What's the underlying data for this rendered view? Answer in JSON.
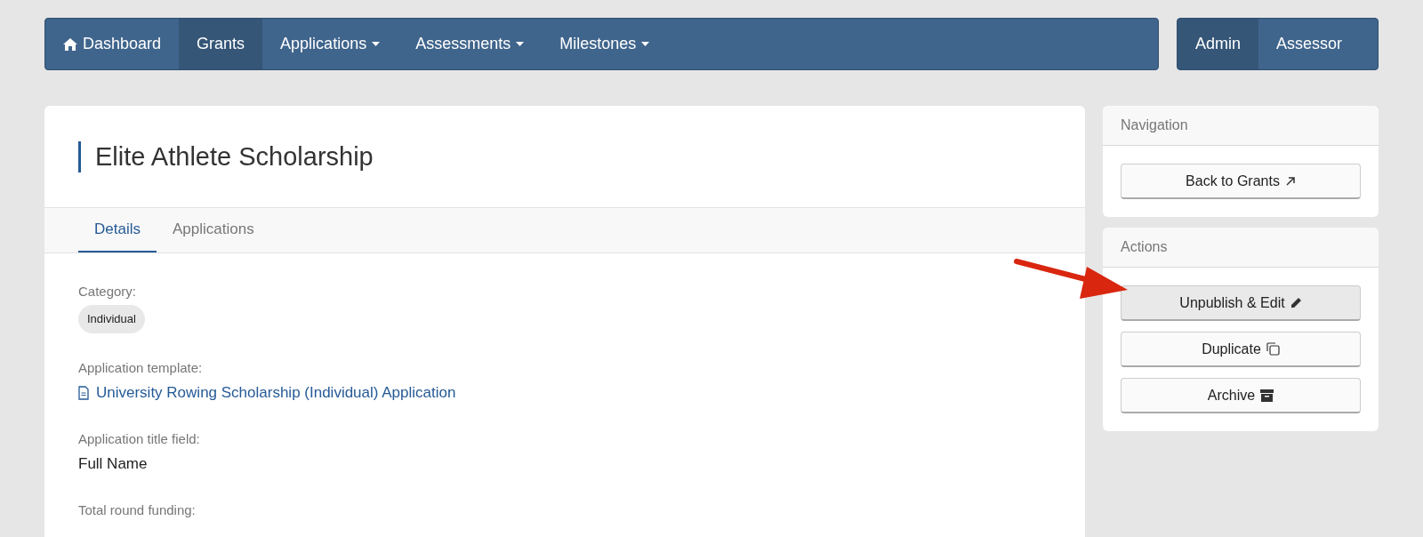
{
  "navbar": {
    "items": [
      {
        "label": "Dashboard",
        "dropdown": false,
        "selected": false
      },
      {
        "label": "Grants",
        "dropdown": false,
        "selected": true
      },
      {
        "label": "Applications",
        "dropdown": true,
        "selected": false
      },
      {
        "label": "Assessments",
        "dropdown": true,
        "selected": false
      },
      {
        "label": "Milestones",
        "dropdown": true,
        "selected": false
      }
    ],
    "roles": [
      {
        "label": "Admin",
        "selected": true
      },
      {
        "label": "Assessor",
        "selected": false
      }
    ]
  },
  "grant": {
    "title": "Elite Athlete Scholarship",
    "tabs": [
      {
        "label": "Details",
        "selected": true
      },
      {
        "label": "Applications",
        "selected": false
      }
    ],
    "fields": [
      {
        "label": "Category:",
        "kind": "tag",
        "value": "Individual"
      },
      {
        "label": "Application template:",
        "kind": "link",
        "value": "University Rowing Scholarship (Individual) Application"
      },
      {
        "label": "Application title field:",
        "kind": "text",
        "value": "Full Name"
      },
      {
        "label": "Total round funding:",
        "kind": "text"
      }
    ]
  },
  "sidebar": [
    {
      "title": "Navigation",
      "buttons": [
        {
          "label": "Back to Grants",
          "highlighted": false
        }
      ]
    },
    {
      "title": "Actions",
      "buttons": [
        {
          "label": "Unpublish & Edit",
          "highlighted": true
        },
        {
          "label": "Duplicate",
          "highlighted": false
        },
        {
          "label": "Archive",
          "highlighted": false
        }
      ]
    }
  ],
  "annotation": {
    "kind": "arrow",
    "color": "#d9260f"
  }
}
